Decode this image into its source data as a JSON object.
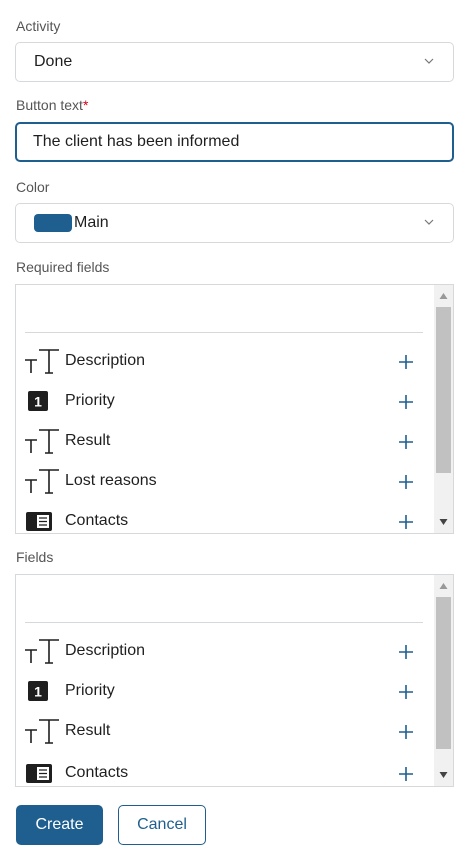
{
  "activity": {
    "label": "Activity",
    "value": "Done"
  },
  "button_text": {
    "label": "Button text",
    "required_mark": "*",
    "value": "The client has been informed"
  },
  "color": {
    "label": "Color",
    "value": "Main",
    "swatch": "#1e5f8f"
  },
  "required_fields": {
    "label": "Required fields",
    "items": [
      {
        "name": "Description",
        "icon": "text-field-icon"
      },
      {
        "name": "Priority",
        "icon": "number-field-icon"
      },
      {
        "name": "Result",
        "icon": "text-field-icon"
      },
      {
        "name": "Lost reasons",
        "icon": "text-field-icon"
      },
      {
        "name": "Contacts",
        "icon": "contact-card-icon"
      }
    ]
  },
  "fields": {
    "label": "Fields",
    "items": [
      {
        "name": "Description",
        "icon": "text-field-icon"
      },
      {
        "name": "Priority",
        "icon": "number-field-icon"
      },
      {
        "name": "Result",
        "icon": "text-field-icon"
      },
      {
        "name": "Contacts",
        "icon": "contact-card-icon"
      }
    ]
  },
  "actions": {
    "create": "Create",
    "cancel": "Cancel"
  },
  "colors": {
    "accent": "#1e5f8f",
    "required": "#d0021b",
    "border": "#d6d9dc"
  }
}
